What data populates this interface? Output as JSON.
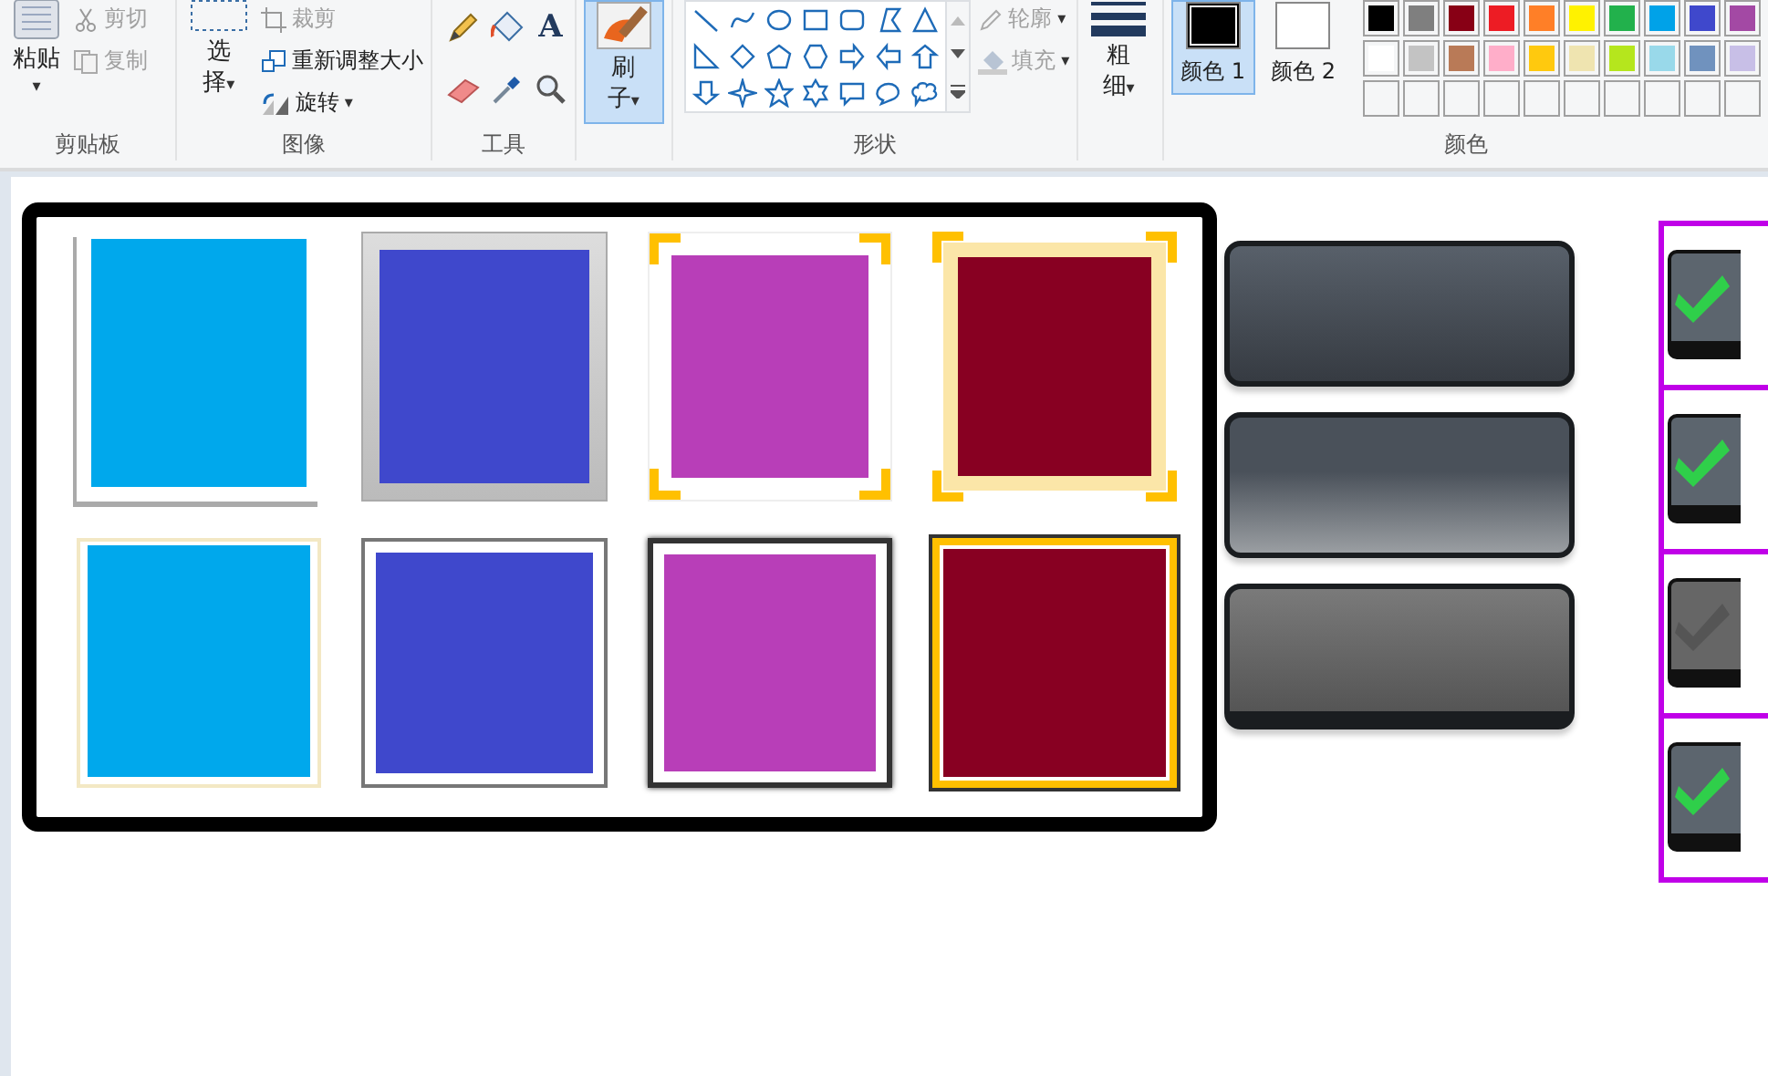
{
  "clipboard": {
    "label": "剪贴板",
    "paste": "粘贴",
    "caret": "▾",
    "items": [
      {
        "label": "剪切",
        "disabled": true
      },
      {
        "label": "复制",
        "disabled": true
      }
    ]
  },
  "image": {
    "label": "图像",
    "select": "选择",
    "caret": "▾",
    "items": [
      {
        "label": "裁剪",
        "disabled": true
      },
      {
        "label": "重新调整大小",
        "disabled": false
      },
      {
        "label": "旋转",
        "disabled": false,
        "caret": "▾"
      }
    ]
  },
  "tools": {
    "label": "工具",
    "text_tool": "A"
  },
  "brushes": {
    "label": "刷子",
    "caret": "▾",
    "selected": true
  },
  "shapes": {
    "label": "形状",
    "items": [
      {
        "label": "轮廓",
        "disabled": true,
        "caret": "▾"
      },
      {
        "label": "填充",
        "disabled": true,
        "caret": "▾"
      }
    ]
  },
  "size": {
    "label": "粗细",
    "caret": "▾"
  },
  "colors": {
    "label": "颜色",
    "slots": [
      {
        "label": "颜色 1",
        "color": "#000000",
        "selected": true
      },
      {
        "label": "颜色 2",
        "color": "#ffffff",
        "selected": false
      }
    ],
    "palette": [
      {
        "color": "#000000"
      },
      {
        "color": "#7f7f7f"
      },
      {
        "color": "#880015"
      },
      {
        "color": "#ed1c24"
      },
      {
        "color": "#ff7f27"
      },
      {
        "color": "#fff200"
      },
      {
        "color": "#22b14c"
      },
      {
        "color": "#00a2e8"
      },
      {
        "color": "#3f48cc"
      },
      {
        "color": "#a349a4"
      },
      {
        "color": "#ffffff"
      },
      {
        "color": "#c3c3c3"
      },
      {
        "color": "#b97a57"
      },
      {
        "color": "#ffaec9"
      },
      {
        "color": "#ffc90e"
      },
      {
        "color": "#efe4b0"
      },
      {
        "color": "#b5e61d"
      },
      {
        "color": "#99d9ea"
      },
      {
        "color": "#7092be"
      },
      {
        "color": "#c8bfe7"
      }
    ]
  }
}
